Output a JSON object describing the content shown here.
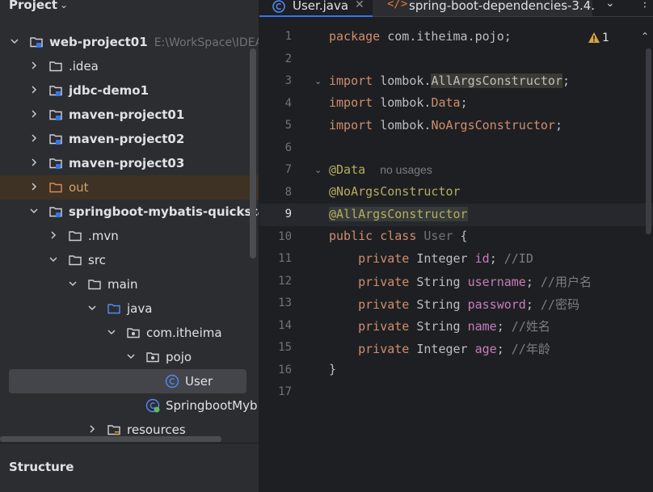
{
  "project_panel": {
    "title": "Project",
    "tree": [
      {
        "label": "web-project01",
        "path": "E:\\WorkSpace\\IDEA",
        "bold": true,
        "icon": "module-folder-icon",
        "expanded": true
      },
      {
        "label": ".idea",
        "bold": false,
        "icon": "folder-icon",
        "expanded": false
      },
      {
        "label": "jdbc-demo1",
        "bold": true,
        "icon": "module-folder-icon",
        "expanded": false
      },
      {
        "label": "maven-project01",
        "bold": true,
        "icon": "module-folder-icon",
        "expanded": false
      },
      {
        "label": "maven-project02",
        "bold": true,
        "icon": "module-folder-icon",
        "expanded": false
      },
      {
        "label": "maven-project03",
        "bold": true,
        "icon": "module-folder-icon",
        "expanded": false
      },
      {
        "label": "out",
        "bold": false,
        "icon": "excluded-folder-icon",
        "expanded": false
      },
      {
        "label": "springboot-mybatis-quickstart",
        "bold": true,
        "icon": "module-folder-icon",
        "expanded": true
      },
      {
        "label": ".mvn",
        "bold": false,
        "icon": "folder-icon",
        "expanded": false
      },
      {
        "label": "src",
        "bold": false,
        "icon": "folder-icon",
        "expanded": true
      },
      {
        "label": "main",
        "bold": false,
        "icon": "folder-icon",
        "expanded": true
      },
      {
        "label": "java",
        "bold": false,
        "icon": "source-folder-icon",
        "expanded": true
      },
      {
        "label": "com.itheima",
        "bold": false,
        "icon": "package-icon",
        "expanded": true
      },
      {
        "label": "pojo",
        "bold": false,
        "icon": "package-icon",
        "expanded": true
      },
      {
        "label": "User",
        "bold": false,
        "icon": "class-icon",
        "selected": true
      },
      {
        "label": "SpringbootMyb",
        "bold": false,
        "icon": "spring-class-icon"
      },
      {
        "label": "resources",
        "bold": false,
        "icon": "resources-folder-icon",
        "expanded": false
      }
    ],
    "structure_title": "Structure"
  },
  "editor": {
    "tabs": [
      {
        "label": "User.java",
        "icon": "class-icon",
        "active": true
      },
      {
        "label": "spring-boot-dependencies-3.4.",
        "icon": "xml-icon",
        "active": false
      }
    ],
    "warning_count": "1",
    "current_line": 9,
    "line_numbers": [
      "1",
      "2",
      "3",
      "4",
      "5",
      "6",
      "7",
      "8",
      "9",
      "10",
      "11",
      "12",
      "13",
      "14",
      "15",
      "16",
      "17"
    ],
    "code": {
      "l1_kw": "package",
      "l1_rest": " com.itheima.pojo;",
      "l3_kw": "import",
      "l3_pre": " lombok.",
      "l3_cls": "AllArgsConstructor",
      "l3_end": ";",
      "l4_kw": "import",
      "l4_pre": " lombok.",
      "l4_cls": "Data",
      "l4_end": ";",
      "l5_kw": "import",
      "l5_pre": " lombok.",
      "l5_cls": "NoArgsConstructor",
      "l5_end": ";",
      "l7_ann": "@Data",
      "l7_inlay": "no usages",
      "l8_ann": "@NoArgsConstructor",
      "l9_ann": "@AllArgsConstructor",
      "l10_kw": "public class",
      "l10_cls": " User",
      "l10_end": " {",
      "l11_kw": "private",
      "l11_type": " Integer ",
      "l11_fld": "id",
      "l11_end": "; ",
      "l11_cmt": "//ID",
      "l12_kw": "private",
      "l12_type": " String ",
      "l12_fld": "username",
      "l12_end": "; ",
      "l12_cmt": "//用户名",
      "l13_kw": "private",
      "l13_type": " String ",
      "l13_fld": "password",
      "l13_end": "; ",
      "l13_cmt": "//密码",
      "l14_kw": "private",
      "l14_type": " String ",
      "l14_fld": "name",
      "l14_end": "; ",
      "l14_cmt": "//姓名",
      "l15_kw": "private",
      "l15_type": " Integer ",
      "l15_fld": "age",
      "l15_end": "; ",
      "l15_cmt": "//年龄",
      "l16": "}"
    }
  }
}
